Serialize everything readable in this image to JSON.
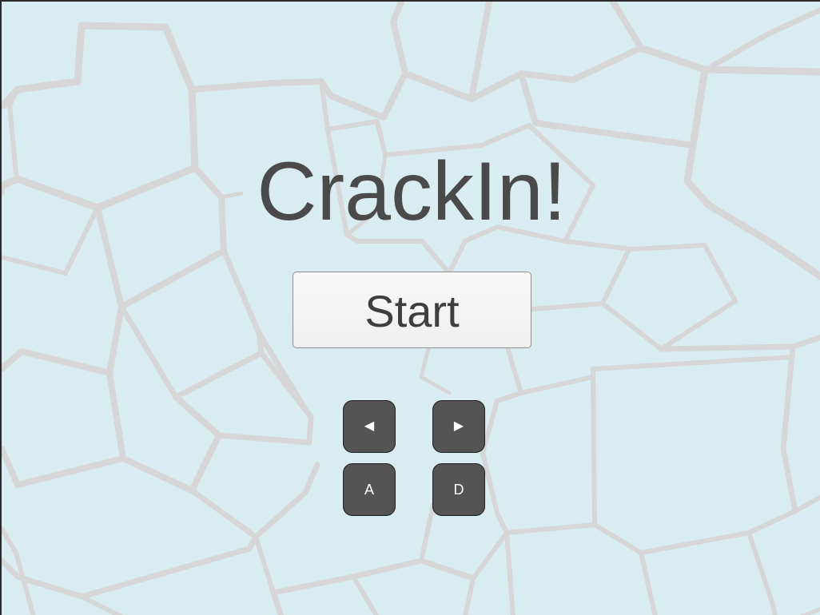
{
  "game": {
    "title": "CrackIn!",
    "start_label": "Start"
  },
  "controls": {
    "left_arrow": "◀",
    "right_arrow": "▶",
    "left_key": "A",
    "right_key": "D"
  },
  "colors": {
    "background": "#d9ecf2",
    "crack_lines": "#d6d6d6",
    "title_text": "#4a4a4a",
    "key_fill": "#545454"
  }
}
